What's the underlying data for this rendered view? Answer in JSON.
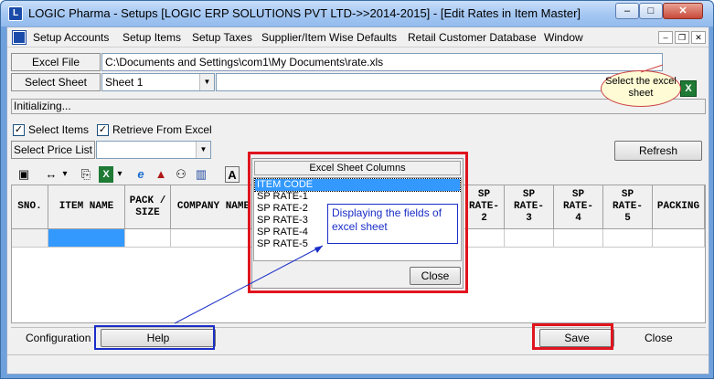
{
  "window": {
    "title": "LOGIC Pharma - Setups  [LOGIC ERP SOLUTIONS PVT LTD->>2014-2015] - [Edit Rates in Item Master]",
    "min_glyph": "–",
    "max_glyph": "□",
    "close_glyph": "✕"
  },
  "menu": {
    "items": [
      "Setup Accounts",
      "Setup Items",
      "Setup Taxes",
      "Supplier/Item Wise Defaults",
      "Retail Customer Database",
      "Window"
    ],
    "mdi_min": "–",
    "mdi_restore": "❐",
    "mdi_close": "✕"
  },
  "form": {
    "excel_file_label": "Excel File",
    "excel_file_value": "C:\\Documents and Settings\\com1\\My Documents\\rate.xls",
    "select_sheet_label": "Select Sheet",
    "select_sheet_value": "Sheet 1",
    "status_text": "Initializing...",
    "select_items_label": "Select Items",
    "retrieve_label": "Retrieve From Excel",
    "select_price_list_label": "Select Price List",
    "select_price_list_value": "",
    "refresh_label": "Refresh",
    "check_glyph": "✓",
    "excel_icon_glyph": "X",
    "select_excel_hint": "Select the excel sheet"
  },
  "toolbar": {
    "icons": [
      "window-icon",
      "move-icon",
      "copy-icon",
      "excel-icon",
      "ie-icon",
      "up-arrow-icon",
      "binoculars-icon",
      "chart-icon",
      "font-icon"
    ],
    "glyphs": [
      "▣",
      "↔",
      "⎘",
      "X",
      "e",
      "▲",
      "⚇",
      "▥",
      "A"
    ],
    "dropdown_glyph": "▾"
  },
  "grid": {
    "columns": [
      "SNO.",
      "ITEM NAME",
      "PACK / SIZE",
      "COMPANY NAME",
      "SP RATE-2",
      "SP RATE-3",
      "SP RATE-4",
      "SP RATE-5",
      "PACKING"
    ]
  },
  "popup": {
    "title": "Excel Sheet Columns",
    "items": [
      "ITEM CODE",
      "SP RATE-1",
      "SP RATE-2",
      "SP RATE-3",
      "SP RATE-4",
      "SP RATE-5"
    ],
    "close_label": "Close"
  },
  "callout": {
    "text": "Displaying the fields of excel sheet"
  },
  "bottom": {
    "configuration_label": "Configuration",
    "help_label": "Help",
    "save_label": "Save",
    "close_label": "Close"
  }
}
